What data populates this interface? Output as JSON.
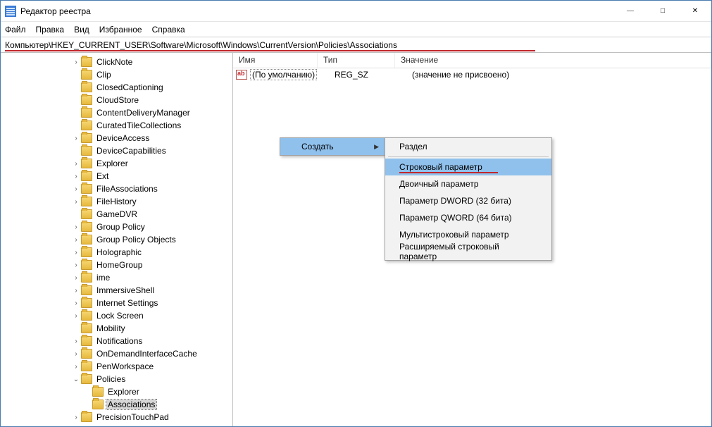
{
  "window": {
    "title": "Редактор реестра"
  },
  "menu": {
    "file": "Файл",
    "edit": "Правка",
    "view": "Вид",
    "favorites": "Избранное",
    "help": "Справка"
  },
  "address": {
    "path": "Компьютер\\HKEY_CURRENT_USER\\Software\\Microsoft\\Windows\\CurrentVersion\\Policies\\Associations"
  },
  "tree": {
    "items": [
      {
        "depth": 5,
        "exp": ">",
        "label": "ClickNote"
      },
      {
        "depth": 5,
        "exp": "",
        "label": "Clip"
      },
      {
        "depth": 5,
        "exp": "",
        "label": "ClosedCaptioning"
      },
      {
        "depth": 5,
        "exp": "",
        "label": "CloudStore"
      },
      {
        "depth": 5,
        "exp": "",
        "label": "ContentDeliveryManager"
      },
      {
        "depth": 5,
        "exp": "",
        "label": "CuratedTileCollections"
      },
      {
        "depth": 5,
        "exp": ">",
        "label": "DeviceAccess"
      },
      {
        "depth": 5,
        "exp": "",
        "label": "DeviceCapabilities"
      },
      {
        "depth": 5,
        "exp": ">",
        "label": "Explorer"
      },
      {
        "depth": 5,
        "exp": ">",
        "label": "Ext"
      },
      {
        "depth": 5,
        "exp": ">",
        "label": "FileAssociations"
      },
      {
        "depth": 5,
        "exp": ">",
        "label": "FileHistory"
      },
      {
        "depth": 5,
        "exp": "",
        "label": "GameDVR"
      },
      {
        "depth": 5,
        "exp": ">",
        "label": "Group Policy"
      },
      {
        "depth": 5,
        "exp": ">",
        "label": "Group Policy Objects"
      },
      {
        "depth": 5,
        "exp": ">",
        "label": "Holographic"
      },
      {
        "depth": 5,
        "exp": ">",
        "label": "HomeGroup"
      },
      {
        "depth": 5,
        "exp": ">",
        "label": "ime"
      },
      {
        "depth": 5,
        "exp": ">",
        "label": "ImmersiveShell"
      },
      {
        "depth": 5,
        "exp": ">",
        "label": "Internet Settings"
      },
      {
        "depth": 5,
        "exp": ">",
        "label": "Lock Screen"
      },
      {
        "depth": 5,
        "exp": "",
        "label": "Mobility"
      },
      {
        "depth": 5,
        "exp": ">",
        "label": "Notifications"
      },
      {
        "depth": 5,
        "exp": ">",
        "label": "OnDemandInterfaceCache"
      },
      {
        "depth": 5,
        "exp": ">",
        "label": "PenWorkspace"
      },
      {
        "depth": 5,
        "exp": "v",
        "label": "Policies"
      },
      {
        "depth": 6,
        "exp": "",
        "label": "Explorer"
      },
      {
        "depth": 6,
        "exp": "",
        "label": "Associations",
        "selected": true
      },
      {
        "depth": 5,
        "exp": ">",
        "label": "PrecisionTouchPad"
      }
    ]
  },
  "list": {
    "headers": {
      "name": "Имя",
      "type": "Тип",
      "value": "Значение"
    },
    "rows": [
      {
        "name": "(По умолчанию)",
        "type": "REG_SZ",
        "value": "(значение не присвоено)"
      }
    ]
  },
  "context": {
    "create": "Создать",
    "submenu": {
      "section": "Раздел",
      "string": "Строковый параметр",
      "binary": "Двоичный параметр",
      "dword": "Параметр DWORD (32 бита)",
      "qword": "Параметр QWORD (64 бита)",
      "multistring": "Мультистроковый параметр",
      "expandstring": "Расширяемый строковый параметр"
    }
  }
}
